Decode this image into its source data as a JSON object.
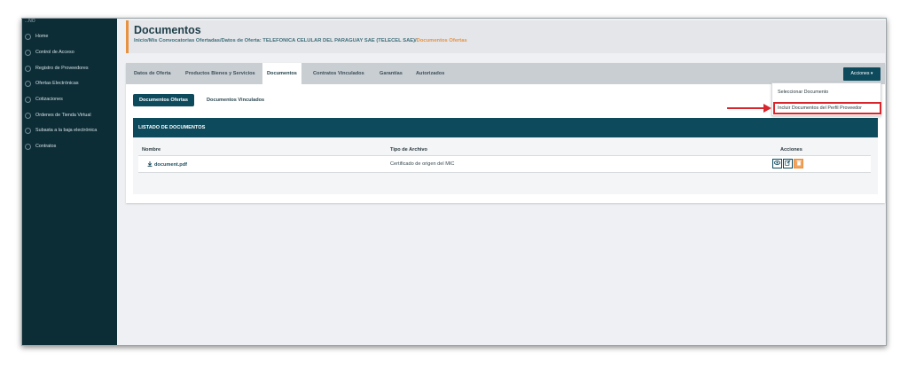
{
  "sidebar": {
    "brand": "...NO",
    "items": [
      {
        "label": "Home"
      },
      {
        "label": "Control de Acceso"
      },
      {
        "label": "Registro de Proveedores"
      },
      {
        "label": "Ofertas Electrónicas"
      },
      {
        "label": "Cotizaciones"
      },
      {
        "label": "Ordenes de Tienda Virtual"
      },
      {
        "label": "Subasta a la baja electrónica"
      },
      {
        "label": "Contratos"
      }
    ]
  },
  "header": {
    "title": "Documentos",
    "breadcrumb_trail": "Inicio/Mis Convocatorias Ofertadas/Datos de Oferta: TELEFONICA CELULAR DEL PARAGUAY SAE (TELECEL SAE)/",
    "breadcrumb_active": "Documentos Ofertas"
  },
  "tabs": [
    {
      "label": "Datos de Oferta"
    },
    {
      "label": "Productos Bienes y Servicios"
    },
    {
      "label": "Documentos"
    },
    {
      "label": "Contratos Vinculados"
    },
    {
      "label": "Garantías"
    },
    {
      "label": "Autorizados"
    }
  ],
  "actions_button": "Acciones ▾",
  "sub_tabs": [
    {
      "label": "Documentos Ofertas"
    },
    {
      "label": "Documentos Vinculados"
    }
  ],
  "dropdown": {
    "items": [
      {
        "label": "Seleccionar Documento"
      },
      {
        "label": "Incluir Documentos del Perfil Proveedor"
      }
    ]
  },
  "list": {
    "title": "LISTADO DE DOCUMENTOS",
    "columns": [
      "Nombre",
      "Tipo de Archivo",
      "Acciones"
    ],
    "rows": [
      {
        "name": "document.pdf",
        "type": "Certificado de origen del MIC"
      }
    ]
  },
  "colors": {
    "sidebar": "#0c2c36",
    "primary": "#0d4a5c",
    "accent": "#e8913f",
    "highlight": "#d9262d"
  },
  "icons": {
    "nav": "circle-icon",
    "download": "download-icon",
    "view": "eye-icon",
    "edit": "edit-icon",
    "delete": "trash-icon"
  }
}
